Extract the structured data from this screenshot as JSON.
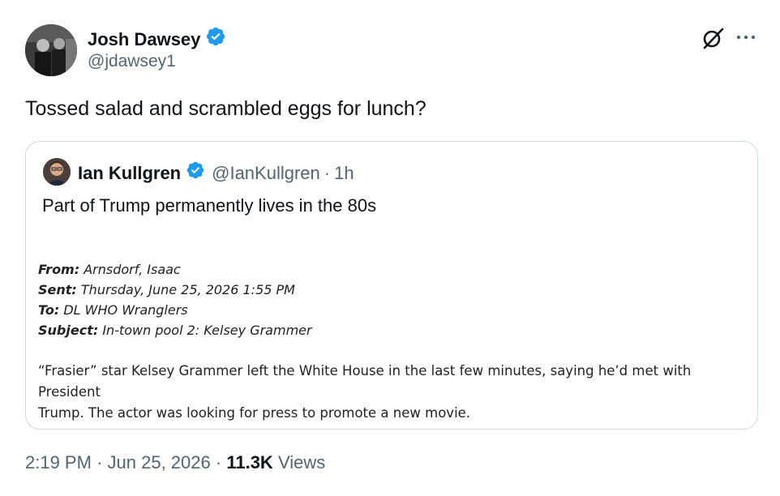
{
  "author": {
    "name": "Josh Dawsey",
    "handle": "@jdawsey1",
    "verified": true
  },
  "tweet": {
    "text": "Tossed salad and scrambled eggs for lunch?"
  },
  "quoted": {
    "name": "Ian Kullgren",
    "handle": "@IanKullgren",
    "separator": "·",
    "time": "1h",
    "text": "Part of Trump permanently lives in the 80s",
    "email": {
      "from_label": "From:",
      "from_value": "Arnsdorf, Isaac",
      "sent_label": "Sent:",
      "sent_value": "Thursday, June 25, 2026 1:55 PM",
      "to_label": "To:",
      "to_value": "DL WHO Wranglers",
      "subject_label": "Subject:",
      "subject_value": "In-town pool 2: Kelsey Grammer",
      "body_line1": "“Frasier” star Kelsey Grammer left the White House in the last few minutes, saying he’d met with President",
      "body_line2": "Trump. The actor was looking for press to promote a new movie."
    }
  },
  "meta": {
    "time": "2:19 PM",
    "sep1": "·",
    "date": "Jun 25, 2026",
    "sep2": "·",
    "views_count": "11.3K",
    "views_label": "Views"
  },
  "colors": {
    "verified_blue": "#1d9bf0",
    "secondary_text": "#536471",
    "border": "#cfd9de"
  },
  "icons": [
    "verified-badge-icon",
    "grok-icon",
    "more-icon"
  ]
}
